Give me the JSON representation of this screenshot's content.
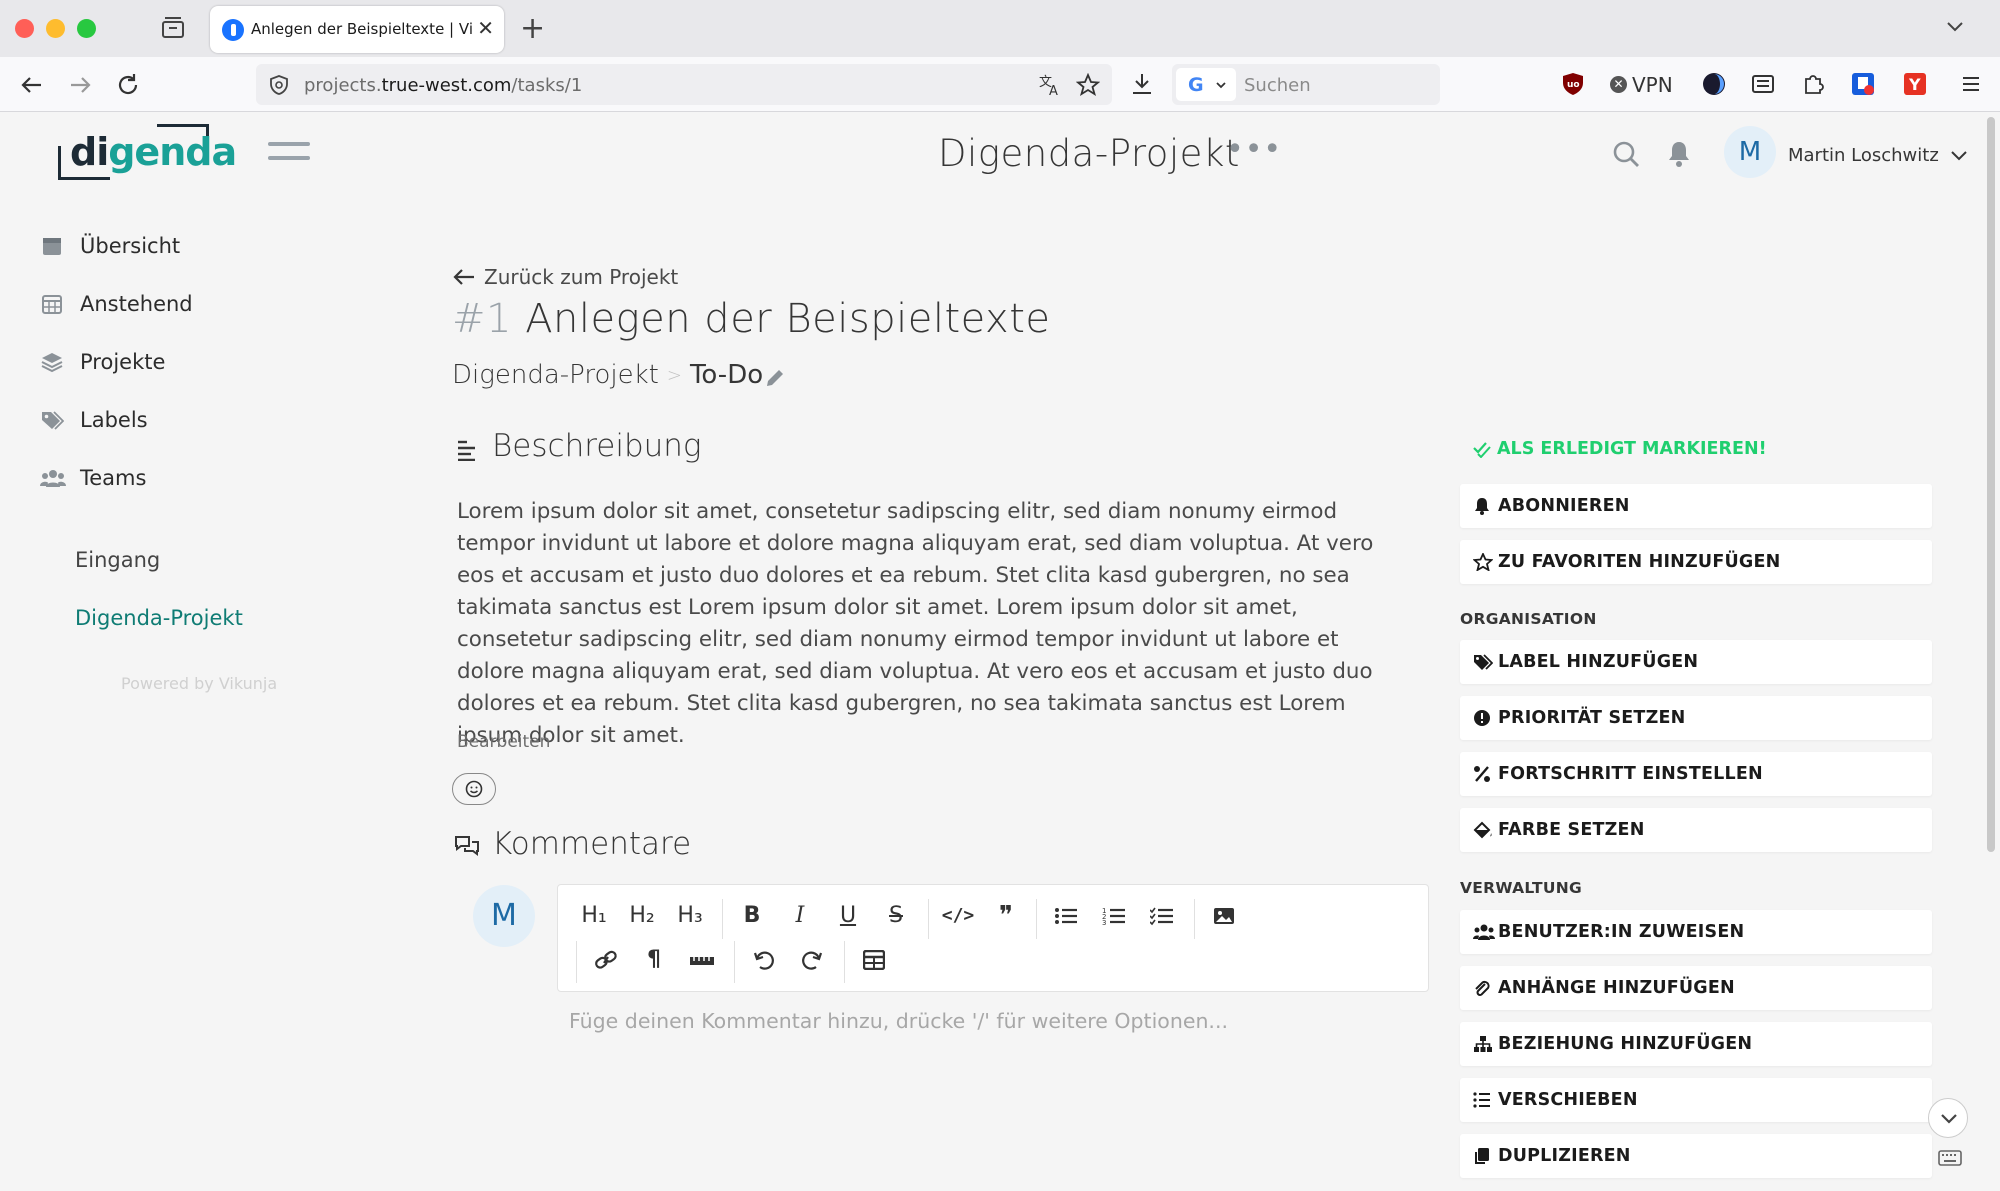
{
  "browser": {
    "tab_title": "Anlegen der Beispieltexte | Vikunja",
    "url_host_prefix": "projects.",
    "url_domain": "true-west.com",
    "url_path": "/tasks/1",
    "search_placeholder": "Suchen",
    "engine_letter": "G",
    "vpn_label": "VPN"
  },
  "header": {
    "logo_di": "di",
    "logo_genda": "genda",
    "project_title": "Digenda-Projekt",
    "more_dots": "•••",
    "avatar_letter": "M",
    "user_name": "Martin Loschwitz"
  },
  "sidebar": {
    "items": [
      {
        "label": "Übersicht",
        "icon": "calendar-icon"
      },
      {
        "label": "Anstehend",
        "icon": "calendar-grid-icon"
      },
      {
        "label": "Projekte",
        "icon": "layers-icon"
      },
      {
        "label": "Labels",
        "icon": "tags-icon"
      },
      {
        "label": "Teams",
        "icon": "users-icon"
      }
    ],
    "projects": [
      "Eingang",
      "Digenda-Projekt"
    ],
    "powered_by": "Powered by Vikunja"
  },
  "task": {
    "back_label": "Zurück zum Projekt",
    "number": "#1",
    "title": "Anlegen der Beispieltexte",
    "breadcrumb_project": "Digenda-Projekt",
    "breadcrumb_sep": ">",
    "breadcrumb_bucket": "To-Do",
    "description_heading": "Beschreibung",
    "description": "Lorem ipsum dolor sit amet, consetetur sadipscing elitr, sed diam nonumy eirmod tempor invidunt ut labore et dolore magna aliquyam erat, sed diam voluptua. At vero eos et accusam et justo duo dolores et ea rebum. Stet clita kasd gubergren, no sea takimata sanctus est Lorem ipsum dolor sit amet. Lorem ipsum dolor sit amet, consetetur sadipscing elitr, sed diam nonumy eirmod tempor invidunt ut labore et dolore magna aliquyam erat, sed diam voluptua. At vero eos et accusam et justo duo dolores et ea rebum. Stet clita kasd gubergren, no sea takimata sanctus est Lorem ipsum dolor sit amet.",
    "edit_label": "Bearbeiten",
    "comments_heading": "Kommentare",
    "comment_avatar": "M",
    "comment_placeholder": "Füge deinen Kommentar hinzu, drücke '/' für weitere Optionen..."
  },
  "editor_toolbar": {
    "h1": "H₁",
    "h2": "H₂",
    "h3": "H₃",
    "bold": "B",
    "italic": "I",
    "underline": "U",
    "strike": "S",
    "code": "</>",
    "quote": "❞",
    "paragraph": "¶"
  },
  "actions": {
    "done": "ALS ERLEDIGT MARKIEREN!",
    "subscribe": "ABONNIEREN",
    "favorite": "ZU FAVORITEN HINZUFÜGEN",
    "group_organisation": "ORGANISATION",
    "label": "LABEL HINZUFÜGEN",
    "priority": "PRIORITÄT SETZEN",
    "progress": "FORTSCHRITT EINSTELLEN",
    "color": "FARBE SETZEN",
    "group_verwaltung": "VERWALTUNG",
    "assign": "BENUTZER:IN ZUWEISEN",
    "attachments": "ANHÄNGE HINZUFÜGEN",
    "relation": "BEZIEHUNG HINZUFÜGEN",
    "move": "VERSCHIEBEN",
    "duplicate": "DUPLIZIEREN"
  },
  "colors": {
    "brand_teal": "#1aa197",
    "brand_dark": "#1d2b36",
    "done_green": "#1fcf6f",
    "active_project": "#0f7c74",
    "avatar_bg": "#e3eff8"
  }
}
